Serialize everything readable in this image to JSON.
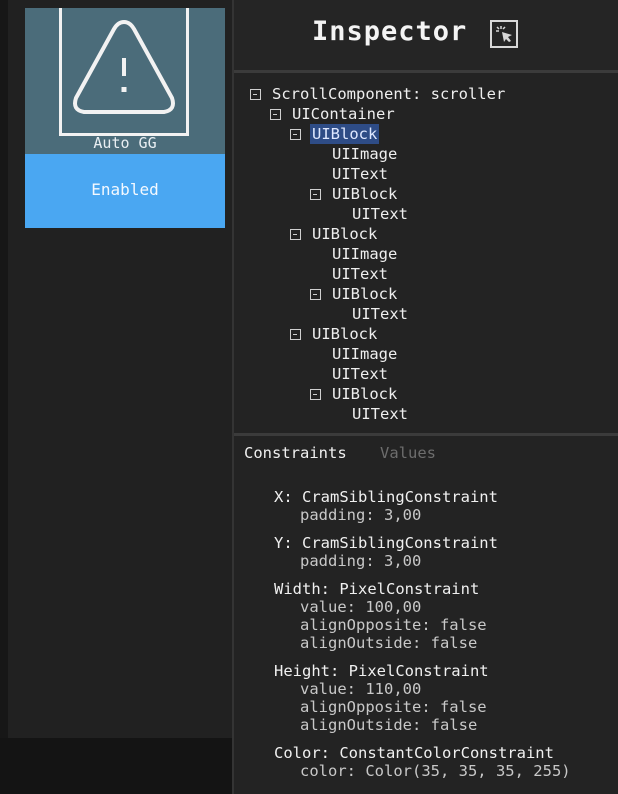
{
  "left": {
    "card_label": "Auto GG",
    "enabled_label": "Enabled",
    "warning_icon": "warning-triangle-icon"
  },
  "inspector": {
    "title": "Inspector",
    "picker_icon": "element-picker-icon",
    "tree": [
      {
        "label": "ScrollComponent: scroller",
        "depth": 0,
        "toggle": true,
        "selected": false
      },
      {
        "label": "UIContainer",
        "depth": 1,
        "toggle": true,
        "selected": false
      },
      {
        "label": "UIBlock",
        "depth": 2,
        "toggle": true,
        "selected": true
      },
      {
        "label": "UIImage",
        "depth": 3,
        "toggle": false,
        "selected": false
      },
      {
        "label": "UIText",
        "depth": 3,
        "toggle": false,
        "selected": false
      },
      {
        "label": "UIBlock",
        "depth": 3,
        "toggle": true,
        "selected": false
      },
      {
        "label": "UIText",
        "depth": 4,
        "toggle": false,
        "selected": false
      },
      {
        "label": "UIBlock",
        "depth": 2,
        "toggle": true,
        "selected": false
      },
      {
        "label": "UIImage",
        "depth": 3,
        "toggle": false,
        "selected": false
      },
      {
        "label": "UIText",
        "depth": 3,
        "toggle": false,
        "selected": false
      },
      {
        "label": "UIBlock",
        "depth": 3,
        "toggle": true,
        "selected": false
      },
      {
        "label": "UIText",
        "depth": 4,
        "toggle": false,
        "selected": false
      },
      {
        "label": "UIBlock",
        "depth": 2,
        "toggle": true,
        "selected": false
      },
      {
        "label": "UIImage",
        "depth": 3,
        "toggle": false,
        "selected": false
      },
      {
        "label": "UIText",
        "depth": 3,
        "toggle": false,
        "selected": false
      },
      {
        "label": "UIBlock",
        "depth": 3,
        "toggle": true,
        "selected": false
      },
      {
        "label": "UIText",
        "depth": 4,
        "toggle": false,
        "selected": false
      }
    ],
    "tabs": {
      "constraints": "Constraints",
      "values": "Values"
    },
    "constraints": [
      {
        "head": "X: CramSiblingConstraint",
        "subs": [
          "padding: 3,00"
        ]
      },
      {
        "head": "Y: CramSiblingConstraint",
        "subs": [
          "padding: 3,00"
        ]
      },
      {
        "head": "Width: PixelConstraint",
        "subs": [
          "value: 100,00",
          "alignOpposite: false",
          "alignOutside: false"
        ]
      },
      {
        "head": "Height: PixelConstraint",
        "subs": [
          "value: 110,00",
          "alignOpposite: false",
          "alignOutside: false"
        ]
      },
      {
        "head": "Color: ConstantColorConstraint",
        "subs": [
          "color: Color(35, 35, 35, 255)"
        ]
      }
    ]
  },
  "colors": {
    "accent": "#4aa7f2",
    "selection": "#2e4c86",
    "card": "#4b6c7a"
  }
}
